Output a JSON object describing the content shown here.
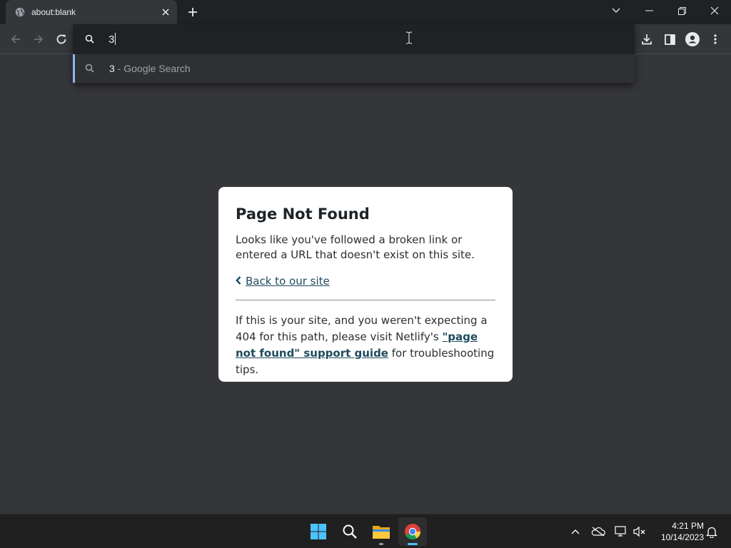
{
  "browser": {
    "tab": {
      "title": "about:blank"
    },
    "omnibox": {
      "typed_text": "3",
      "suggestion": {
        "query": "3",
        "suffix": " - Google Search"
      }
    },
    "accent_color": "#8ab4f8"
  },
  "page": {
    "heading": "Page Not Found",
    "intro": "Looks like you've followed a broken link or entered a URL that doesn't exist on this site.",
    "back_link": "Back to our site",
    "body_before": "If this is your site, and you weren't expecting a 404 for this path, please visit Netlify's ",
    "body_link": "\"page not found\" support guide",
    "body_after": " for troubleshooting tips.",
    "link_color": "#1f4a5e"
  },
  "taskbar": {
    "apps": [
      "start-icon",
      "search-icon",
      "file-explorer-icon",
      "chrome-icon"
    ],
    "clock": {
      "time": "4:21 PM",
      "date": "10/14/2023"
    }
  }
}
